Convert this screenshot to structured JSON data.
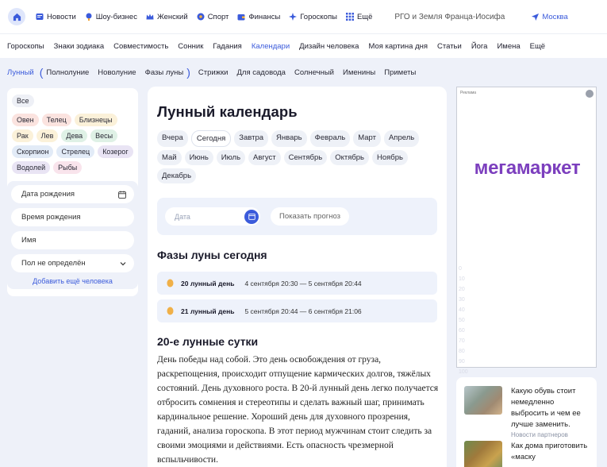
{
  "topbar": {
    "items": [
      {
        "label": "Новости",
        "icon": "news-icon"
      },
      {
        "label": "Шоу-бизнес",
        "icon": "showbiz-icon"
      },
      {
        "label": "Женский",
        "icon": "crown-icon"
      },
      {
        "label": "Спорт",
        "icon": "sport-icon"
      },
      {
        "label": "Финансы",
        "icon": "finance-icon"
      },
      {
        "label": "Гороскопы",
        "icon": "sparkle-icon"
      },
      {
        "label": "Ещё",
        "icon": "grid-icon"
      }
    ],
    "promo": "РГО и Земля Франца-Иосифа",
    "city": "Москва"
  },
  "nav2": [
    "Гороскопы",
    "Знаки зодиака",
    "Совместимость",
    "Сонник",
    "Гадания",
    "Календари",
    "Дизайн человека",
    "Моя картина дня",
    "Статьи",
    "Йога",
    "Имена",
    "Ещё"
  ],
  "nav3": [
    "Лунный",
    "Полнолуние",
    "Новолуние",
    "Фазы луны",
    "Стрижки",
    "Для садовода",
    "Солнечный",
    "Именины",
    "Приметы"
  ],
  "zodiac": [
    "Все",
    "Овен",
    "Телец",
    "Близнецы",
    "Рак",
    "Лев",
    "Дева",
    "Весы",
    "Скорпион",
    "Стрелец",
    "Козерог",
    "Водолей",
    "Рыбы"
  ],
  "form": {
    "birth_date": "Дата рождения",
    "birth_time": "Время рождения",
    "name": "Имя",
    "gender": "Пол не определён",
    "add": "Добавить ещё человека"
  },
  "main": {
    "title": "Лунный календарь",
    "periods": [
      "Вчера",
      "Сегодня",
      "Завтра",
      "Январь",
      "Февраль",
      "Март",
      "Апрель",
      "Май",
      "Июнь",
      "Июль",
      "Август",
      "Сентябрь",
      "Октябрь",
      "Ноябрь",
      "Декабрь"
    ],
    "date_placeholder": "Дата",
    "show_button": "Показать прогноз",
    "phases_title": "Фазы луны сегодня",
    "phases": [
      {
        "day": "20 лунный день",
        "range": "4 сентября 20:30 — 5 сентября 20:44"
      },
      {
        "day": "21 лунный день",
        "range": "5 сентября 20:44 — 6 сентября 21:06"
      }
    ],
    "day_title": "20-е лунные сутки",
    "day_text": "День победы над собой. Это день освобождения от груза, раскрепощения, происходит отпущение кармических долгов, тяжёлых состояний. День духовного роста. В 20-й лунный день легко получается отбросить сомнения и стереотипы и сделать важный шаг, принимать кардинальное решение. Хороший день для духовного прозрения, гаданий, анализа гороскопа. В этот период мужчинам стоит следить за своими эмоциями и действиями. Есть опасность чрезмерной вспыльчивости."
  },
  "ad": {
    "label": "Реклама",
    "brand": "мегамаркет",
    "ruler": [
      "0",
      "10",
      "20",
      "30",
      "40",
      "50",
      "60",
      "70",
      "80",
      "90",
      "100"
    ]
  },
  "news": {
    "item1": "Какую обувь стоит немедленно выбросить и чем ее лучше заменить.",
    "source": "Новости партнеров",
    "item2": "Как дома приготовить «маску"
  },
  "colors": {
    "accent": "#3b5bdb",
    "brand": "#7c3fbe",
    "moon": "#f0b048"
  }
}
